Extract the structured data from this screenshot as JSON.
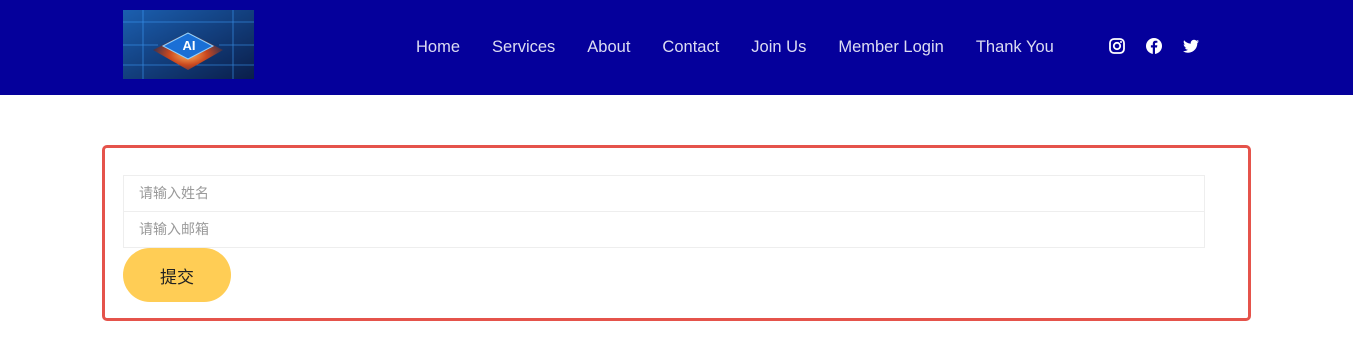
{
  "header": {
    "background": "#05009b",
    "logo": {
      "text": "AI"
    },
    "nav": [
      {
        "label": "Home"
      },
      {
        "label": "Services"
      },
      {
        "label": "About"
      },
      {
        "label": "Contact"
      },
      {
        "label": "Join Us"
      },
      {
        "label": "Member Login"
      },
      {
        "label": "Thank You"
      }
    ],
    "social": [
      {
        "icon": "instagram-icon"
      },
      {
        "icon": "facebook-icon"
      },
      {
        "icon": "twitter-icon"
      }
    ]
  },
  "form": {
    "border_color": "#e5534b",
    "name_placeholder": "请输入姓名",
    "email_placeholder": "请输入邮箱",
    "submit_label": "提交",
    "submit_color": "#ffcd55"
  }
}
